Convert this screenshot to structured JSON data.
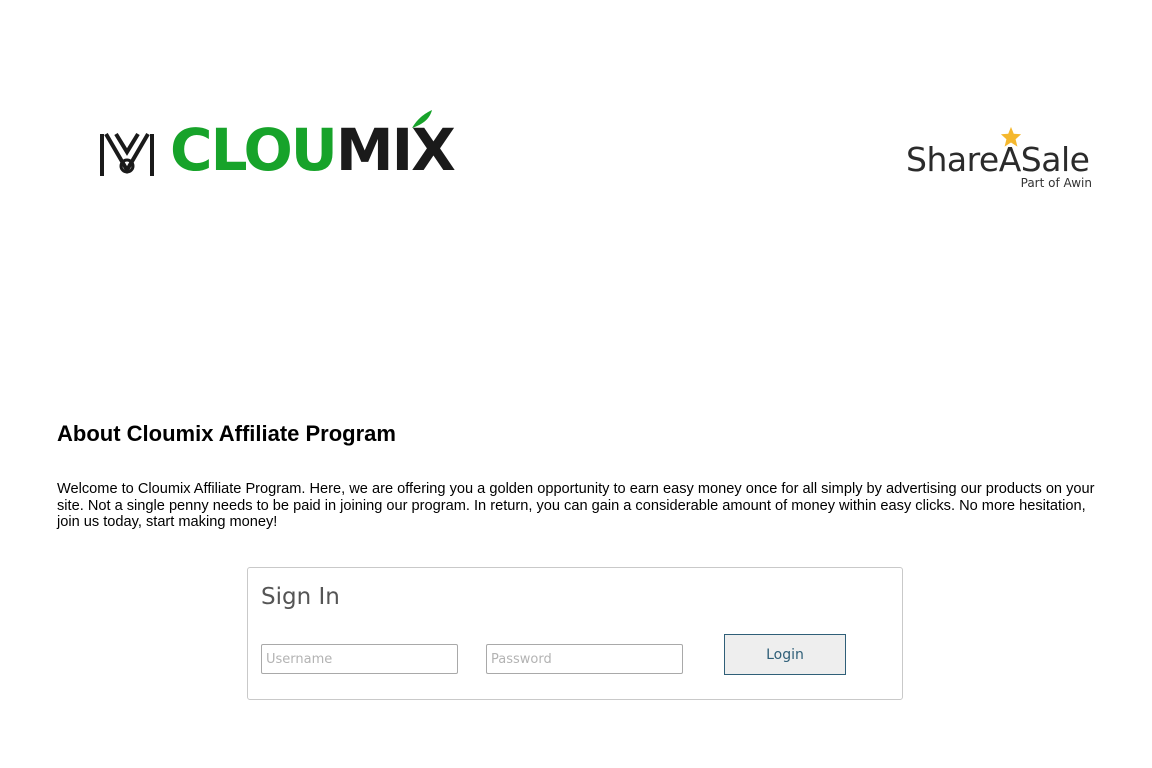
{
  "header": {
    "cloumix_logo": {
      "brand_part_green": "CLOU",
      "brand_part_dark": "MIX",
      "green_color": "#17a32a",
      "dark_color": "#1a1a1a"
    },
    "network_logo": {
      "name": "ShareASale",
      "subtitle": "Part of Awin",
      "star_color": "#f5b82e"
    }
  },
  "about": {
    "heading": "About Cloumix Affiliate Program",
    "body": "Welcome to Cloumix Affiliate Program. Here, we are offering you a golden opportunity to earn easy money once for all simply by advertising our products on your site. Not a single penny needs to be paid in joining our program. In return, you can gain a considerable amount of money within easy clicks. No more hesitation, join us today, start making money!"
  },
  "signin": {
    "title": "Sign In",
    "username_placeholder": "Username",
    "username_value": "",
    "password_placeholder": "Password",
    "password_value": "",
    "login_label": "Login",
    "accent_color": "#2f5f78"
  }
}
